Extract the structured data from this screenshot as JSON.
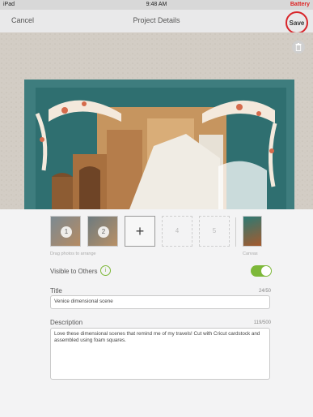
{
  "status_bar": {
    "carrier": "iPad",
    "time": "9:48 AM",
    "battery": "Battery"
  },
  "nav": {
    "cancel": "Cancel",
    "title": "Project Details",
    "save": "Save"
  },
  "photos": {
    "slots": [
      {
        "label": "1",
        "state": "photo"
      },
      {
        "label": "2",
        "state": "photo"
      },
      {
        "label": "+",
        "state": "add"
      },
      {
        "label": "4",
        "state": "empty"
      },
      {
        "label": "5",
        "state": "empty"
      }
    ],
    "hint": "Drag photos to arrange",
    "canvas_label": "Canvas"
  },
  "visibility": {
    "label": "Visible to Others",
    "enabled": true,
    "toggle_color": "#7db839"
  },
  "title_field": {
    "label": "Title",
    "counter": "24/50",
    "value": "Venice dimensional scene"
  },
  "description_field": {
    "label": "Description",
    "counter": "119/500",
    "value": "Love these dimensional scenes that remind me of my travels! Cut with Cricut cardstock and assembled using foam squares."
  },
  "colors": {
    "accent_red": "#d8252a",
    "accent_green": "#7db839"
  }
}
